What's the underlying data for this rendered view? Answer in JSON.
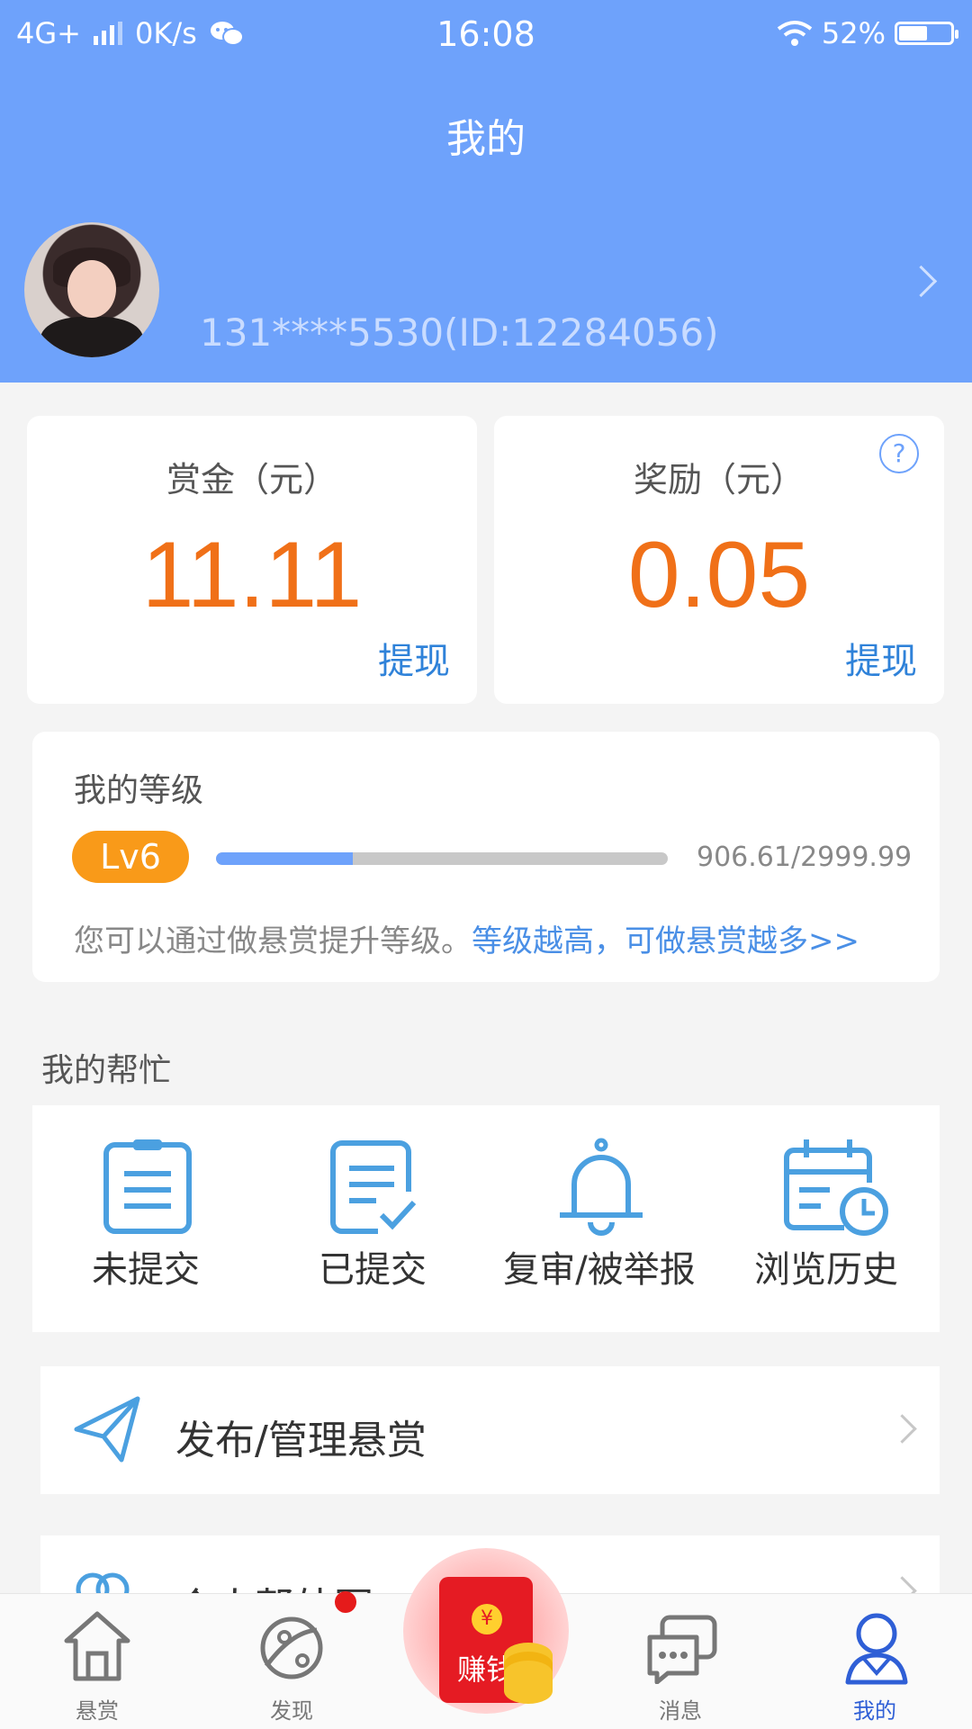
{
  "status_bar": {
    "network": "4G+",
    "speed": "0K/s",
    "time": "16:08",
    "battery": "52%",
    "battery_level": 0.52
  },
  "header": {
    "title": "我的"
  },
  "profile": {
    "user_id": "131****5530(ID:12284056)"
  },
  "wallet": {
    "bounty": {
      "title": "赏金（元）",
      "value": "11.11",
      "action": "提现"
    },
    "reward": {
      "title": "奖励（元）",
      "value": "0.05",
      "action": "提现",
      "help": "?"
    }
  },
  "level": {
    "title": "我的等级",
    "badge": "Lv6",
    "progress_text": "906.61/2999.99",
    "progress_fraction": 0.302,
    "hint": "您可以通过做悬赏提升等级。",
    "hint_link": "等级越高，可做悬赏越多>>"
  },
  "my_help": {
    "title": "我的帮忙",
    "items": [
      {
        "label": "未提交",
        "icon": "clipboard-icon"
      },
      {
        "label": "已提交",
        "icon": "checked-doc-icon"
      },
      {
        "label": "复审/被举报",
        "icon": "bell-icon"
      },
      {
        "label": "浏览历史",
        "icon": "calendar-clock-icon"
      }
    ]
  },
  "menu": {
    "publish": "发布/管理悬赏",
    "partial_next": "个人帮外圈"
  },
  "tabbar": {
    "items": [
      {
        "label": "悬赏",
        "icon": "home-icon"
      },
      {
        "label": "发现",
        "icon": "planet-icon"
      },
      {
        "label": "赚钱",
        "icon": "red-envelope-icon"
      },
      {
        "label": "消息",
        "icon": "chat-icon"
      },
      {
        "label": "我的",
        "icon": "profile-icon"
      }
    ],
    "active": "我的",
    "envelope_symbol": "¥"
  },
  "colors": {
    "header_bg": "#6ea2fb",
    "amount": "#f07018",
    "link": "#2f82d9",
    "badge": "#f99a19"
  }
}
